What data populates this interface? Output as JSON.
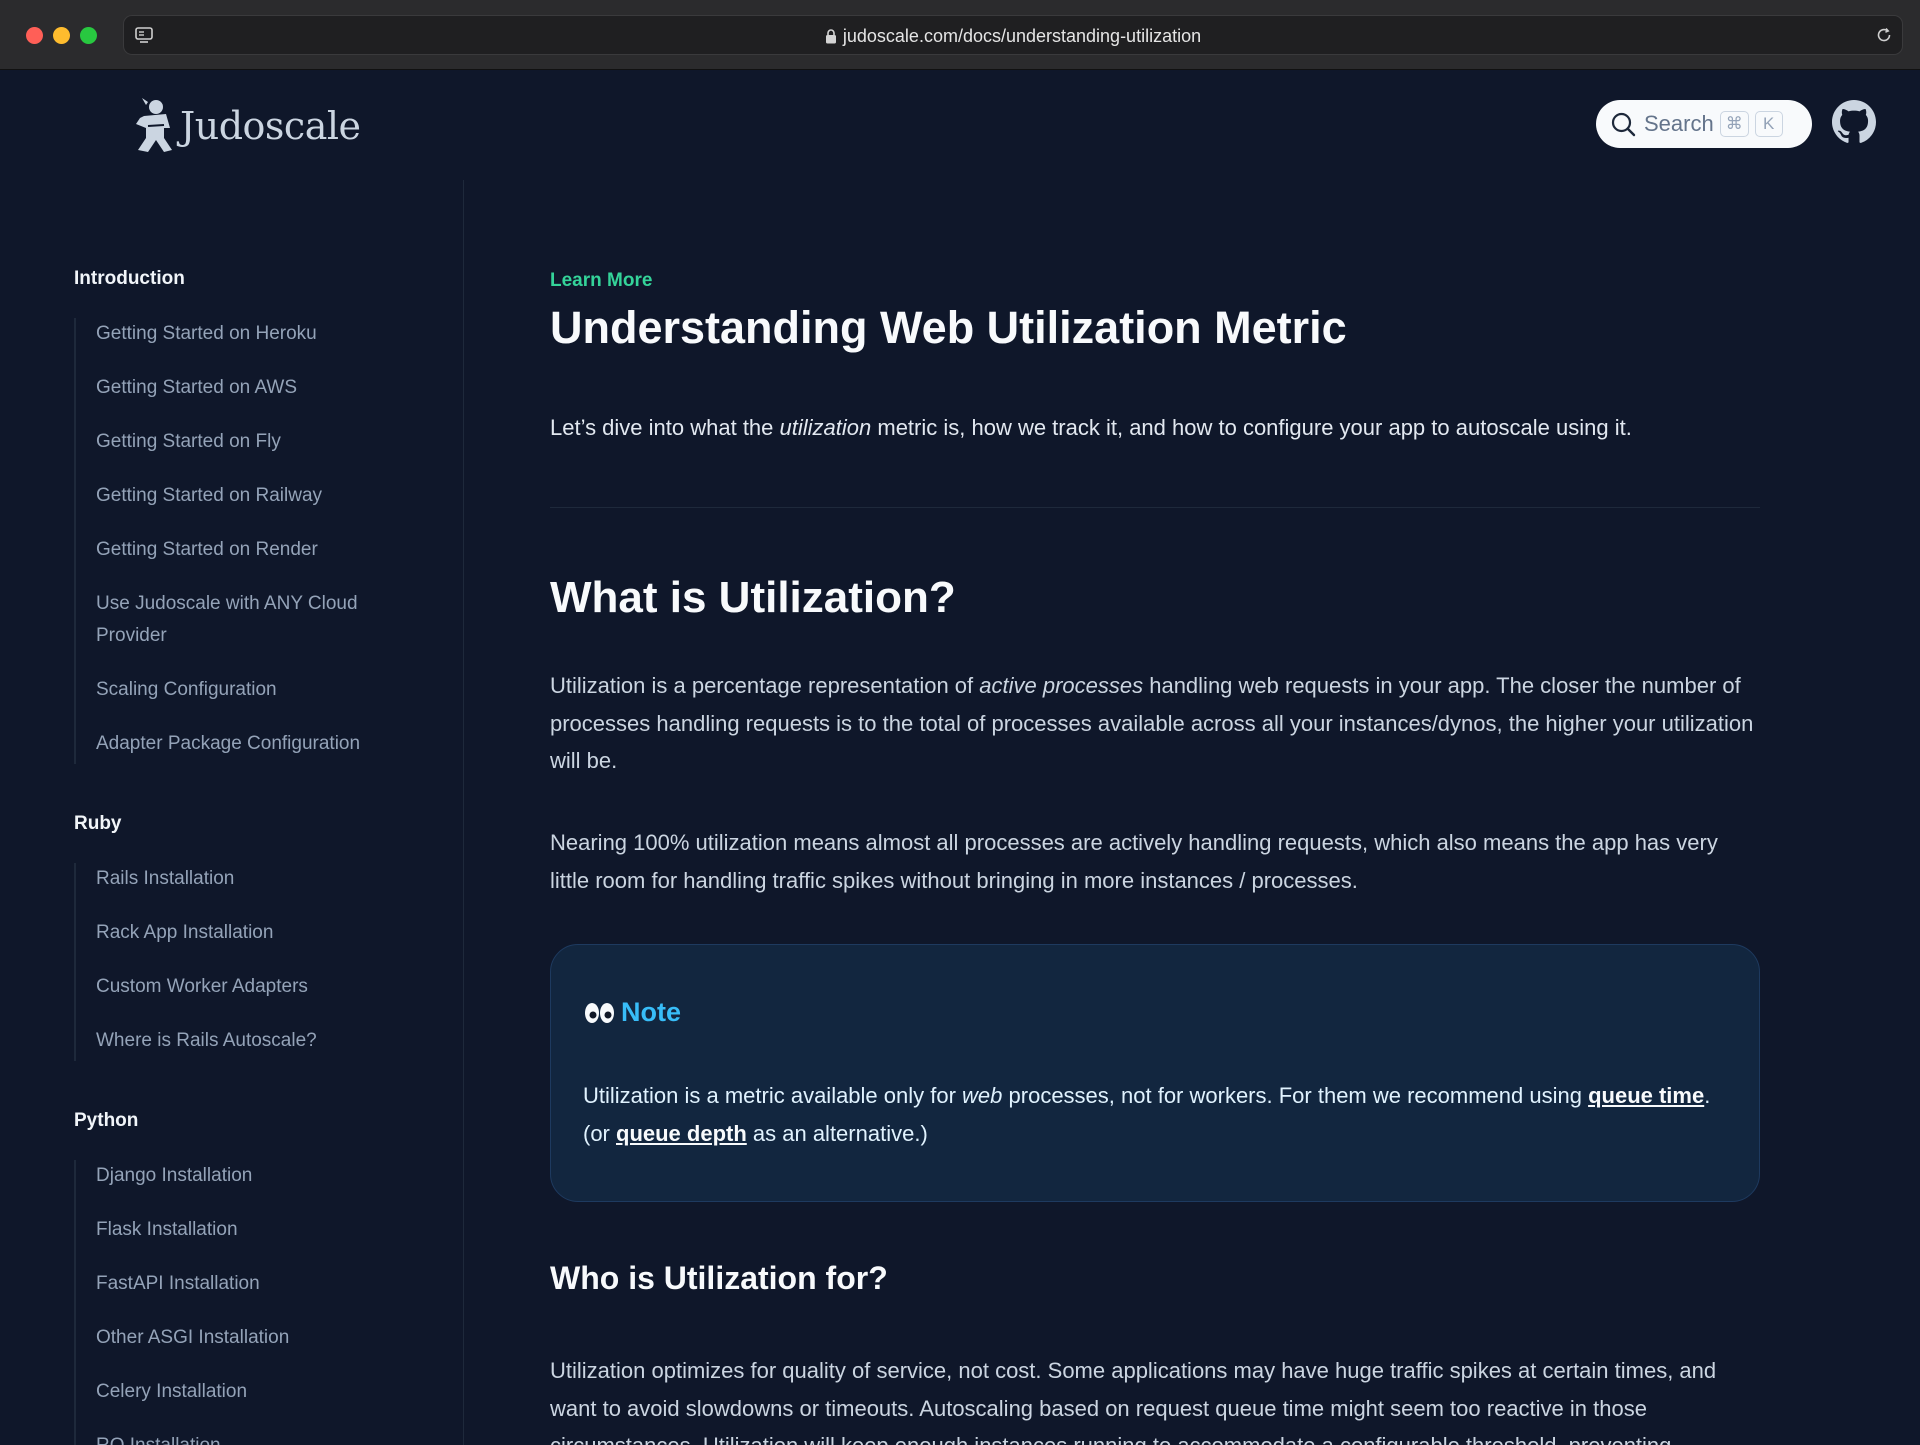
{
  "browser": {
    "url": "judoscale.com/docs/understanding-utilization"
  },
  "header": {
    "logo_text": "Judoscale",
    "search_label": "Search",
    "kbd_cmd": "⌘",
    "kbd_k": "K"
  },
  "sidebar": {
    "sections": [
      {
        "title": "Introduction",
        "items": [
          "Getting Started on Heroku",
          "Getting Started on AWS",
          "Getting Started on Fly",
          "Getting Started on Railway",
          "Getting Started on Render",
          "Use Judoscale with ANY Cloud Provider",
          "Scaling Configuration",
          "Adapter Package Configuration"
        ]
      },
      {
        "title": "Ruby",
        "items": [
          "Rails Installation",
          "Rack App Installation",
          "Custom Worker Adapters",
          "Where is Rails Autoscale?"
        ]
      },
      {
        "title": "Python",
        "items": [
          "Django Installation",
          "Flask Installation",
          "FastAPI Installation",
          "Other ASGI Installation",
          "Celery Installation",
          "RQ Installation"
        ]
      }
    ]
  },
  "main": {
    "eyebrow": "Learn More",
    "title": "Understanding Web Utilization Metric",
    "lead_1": "Let’s dive into what the ",
    "lead_em": "utilization",
    "lead_2": " metric is, how we track it, and how to configure your app to autoscale using it.",
    "h2": "What is Utilization?",
    "p1_a": "Utilization is a percentage representation of ",
    "p1_em": "active processes",
    "p1_b": " handling web requests in your app. The closer the number of processes handling requests is to the total of processes available across all your instances/dynos, the higher your utilization will be.",
    "p2": "Nearing 100% utilization means almost all processes are actively handling requests, which also means the app has very little room for handling traffic spikes without bringing in more instances / processes.",
    "note": {
      "title": "Note",
      "body_a": "Utilization is a metric available only for ",
      "body_em": "web",
      "body_b": " processes, not for workers. For them we recommend using ",
      "link1": "queue time",
      "body_c": ". (or ",
      "link2": "queue depth",
      "body_d": " as an alternative.)"
    },
    "h3": "Who is Utilization for?",
    "p3": "Utilization optimizes for quality of service, not cost. Some applications may have huge traffic spikes at certain times, and want to avoid slowdowns or timeouts. Autoscaling based on request queue time might seem too reactive in those circumstances. Utilization will keep enough instances running to accommodate a configurable threshold, preventing"
  }
}
